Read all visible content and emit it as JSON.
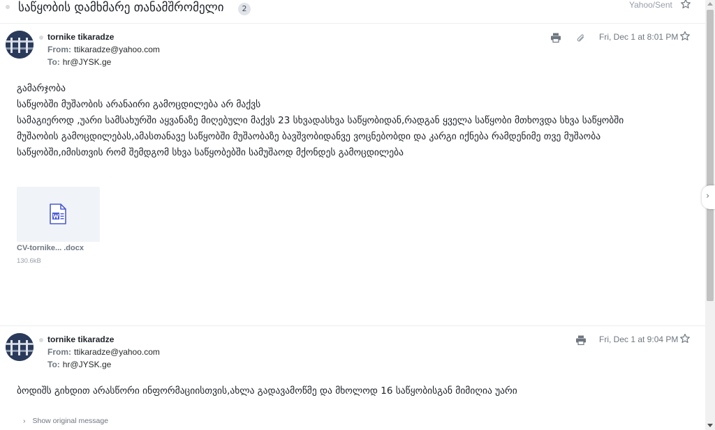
{
  "header": {
    "subject": "საწყობის დამხმარე თანამშრომელი",
    "count": "2",
    "folder": "Yahoo/Sent"
  },
  "messages": [
    {
      "sender": "tornike tikaradze",
      "from_label": "From:",
      "from": "ttikaradze@yahoo.com",
      "to_label": "To:",
      "to": "hr@JYSK.ge",
      "date": "Fri, Dec 1 at 8:01 PM",
      "body": [
        "გამარჯობა",
        "საწყობში მუშაობის არანაირი გამოცდილება არ მაქვს",
        "სამაგიეროდ ,უარი სამსახურში აყვანაზე მიღებული მაქვს 23 სხვადასხვა საწყობიდან,რადგან ყველა საწყობი მთხოვდა სხვა საწყობში",
        "მუშაობის გამოცდილებას,ამასთანავე საწყობში მუშაობაზე ბავშვობიდანვე ვოცნებობდი და კარგი იქნება რამდენიმე თვე მუშაობა",
        "საწყობში,იმისთვის რომ შემდგომ სხვა საწყობებში სამუშაოდ მქონდეს გამოცდილება"
      ],
      "attachment": {
        "name": "CV-tornike... .docx",
        "size": "130.6kB",
        "icon": "word-document-icon"
      }
    },
    {
      "sender": "tornike tikaradze",
      "from_label": "From:",
      "from": "ttikaradze@yahoo.com",
      "to_label": "To:",
      "to": "hr@JYSK.ge",
      "date": "Fri, Dec 1 at 9:04 PM",
      "body": [
        "ბოდიშს გიხდით არასწორი ინფორმაციისთვის,ახლა გადავამოწმე და მხოლოდ 16 საწყობისგან მიმიღია უარი"
      ],
      "show_original": "Show original message"
    }
  ],
  "colors": {
    "avatar_bg": "#2a3a5a",
    "word_blue": "#4a5bd6",
    "muted": "#6e7780"
  }
}
